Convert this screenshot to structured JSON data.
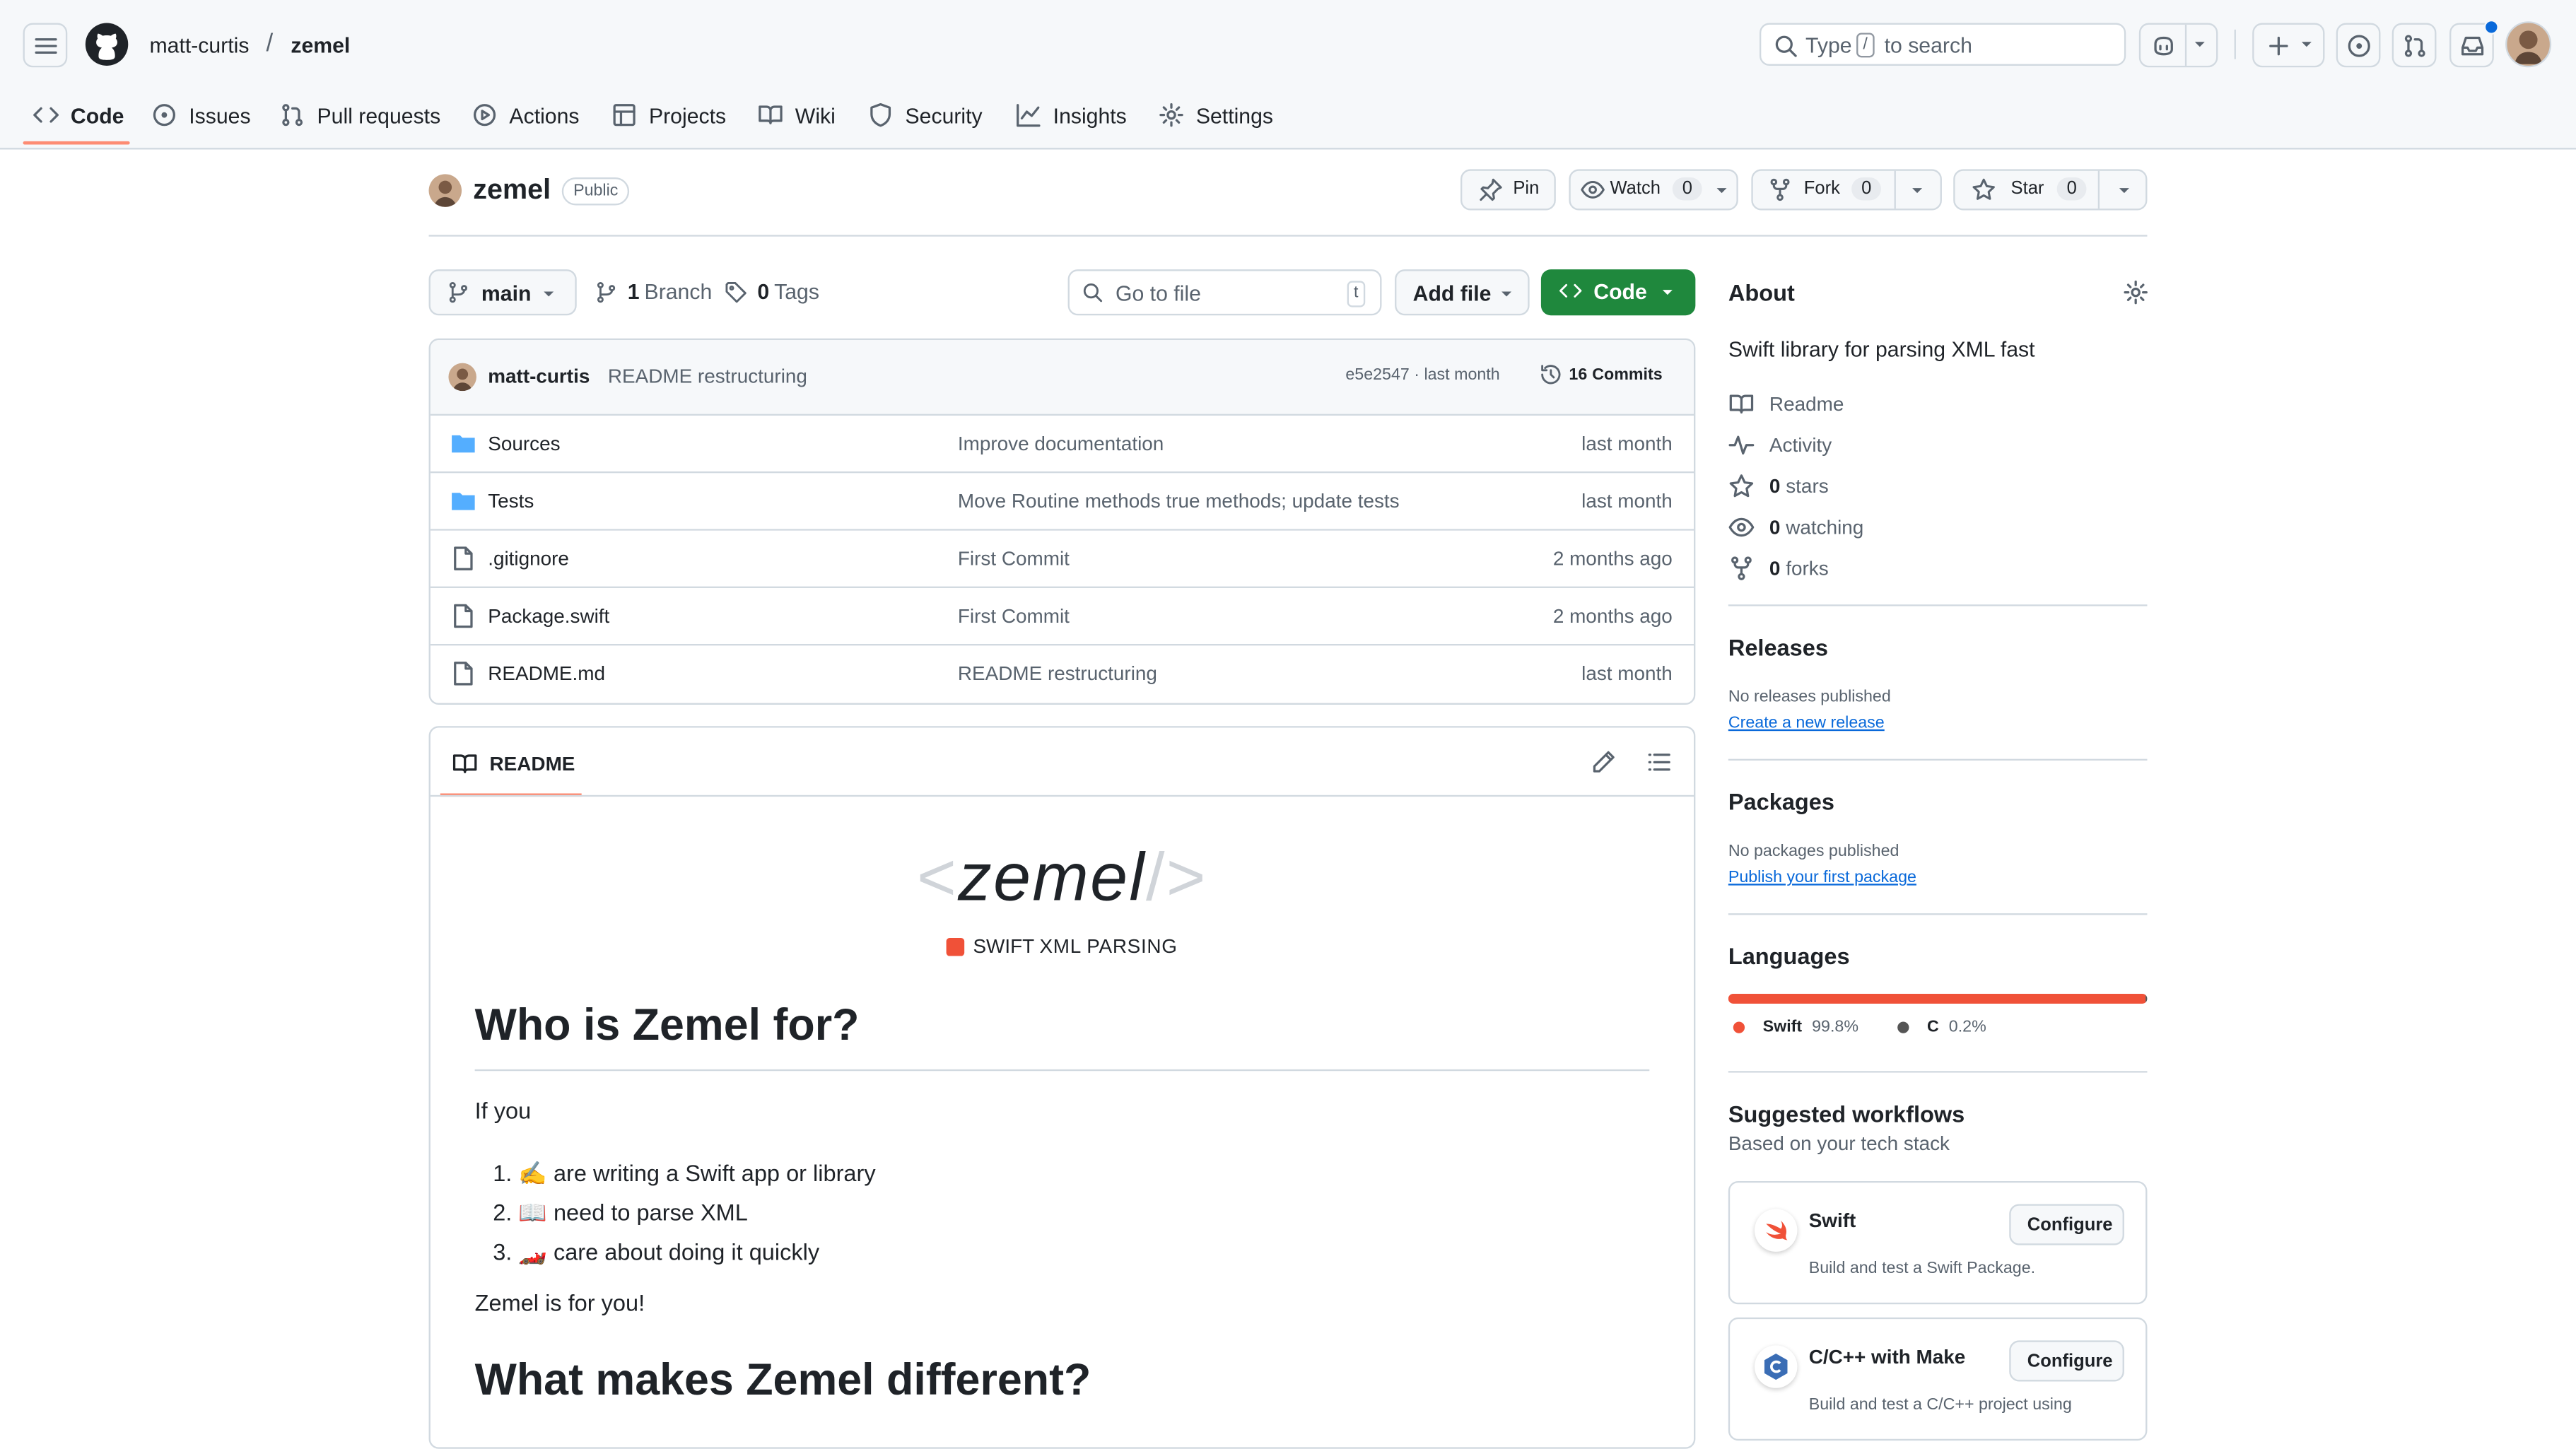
{
  "header": {
    "owner": "matt-curtis",
    "separator": "/",
    "repo": "zemel",
    "search_pre": "Type",
    "search_key": "/",
    "search_post": "to search",
    "notification_color": "#0969da"
  },
  "tabs": [
    {
      "label": "Code",
      "icon": "code-icon"
    },
    {
      "label": "Issues",
      "icon": "issue-icon"
    },
    {
      "label": "Pull requests",
      "icon": "pull-request-icon"
    },
    {
      "label": "Actions",
      "icon": "play-icon"
    },
    {
      "label": "Projects",
      "icon": "table-icon"
    },
    {
      "label": "Wiki",
      "icon": "book-icon"
    },
    {
      "label": "Security",
      "icon": "shield-icon"
    },
    {
      "label": "Insights",
      "icon": "graph-icon"
    },
    {
      "label": "Settings",
      "icon": "gear-icon"
    }
  ],
  "repo": {
    "name": "zemel",
    "visibility": "Public",
    "pin_label": "Pin",
    "watch_label": "Watch",
    "watch_count": "0",
    "fork_label": "Fork",
    "fork_count": "0",
    "star_label": "Star",
    "star_count": "0"
  },
  "toolbar": {
    "branch": "main",
    "branches_count": "1",
    "branches_label": "Branch",
    "tags_count": "0",
    "tags_label": "Tags",
    "go_to_file_placeholder": "Go to file",
    "go_to_file_key": "t",
    "add_file_label": "Add file",
    "code_label": "Code"
  },
  "commit": {
    "author": "matt-curtis",
    "message": "README restructuring",
    "hash_time": "e5e2547 · last month",
    "commits_count": "16",
    "commits_label": "Commits"
  },
  "files": [
    {
      "name": "Sources",
      "type": "dir",
      "message": "Improve documentation",
      "time": "last month"
    },
    {
      "name": "Tests",
      "type": "dir",
      "message": "Move Routine methods true methods; update tests",
      "time": "last month"
    },
    {
      "name": ".gitignore",
      "type": "file",
      "message": "First Commit",
      "time": "2 months ago"
    },
    {
      "name": "Package.swift",
      "type": "file",
      "message": "First Commit",
      "time": "2 months ago"
    },
    {
      "name": "README.md",
      "type": "file",
      "message": "README restructuring",
      "time": "last month"
    }
  ],
  "readme": {
    "tab_label": "README",
    "logo_open": "<",
    "logo_text": "zemel",
    "logo_close": "/>",
    "subtitle_a": "SWIFT ",
    "subtitle_b": "XML PARSING",
    "h1": "Who is Zemel for?",
    "intro": "If you",
    "list": [
      "✍️ are writing a Swift app or library",
      "📖 need to parse XML",
      "🏎️ care about doing it quickly"
    ],
    "closing": "Zemel is for you!",
    "h2": "What makes Zemel different?"
  },
  "about": {
    "title": "About",
    "description": "Swift library for parsing XML fast",
    "links": [
      {
        "icon": "book-icon",
        "bold": "",
        "label": "Readme"
      },
      {
        "icon": "pulse-icon",
        "bold": "",
        "label": "Activity"
      },
      {
        "icon": "star-icon",
        "bold": "0",
        "label": "stars"
      },
      {
        "icon": "eye-icon",
        "bold": "0",
        "label": "watching"
      },
      {
        "icon": "fork-icon",
        "bold": "0",
        "label": "forks"
      }
    ]
  },
  "releases": {
    "title": "Releases",
    "empty": "No releases published",
    "link": "Create a new release"
  },
  "packages": {
    "title": "Packages",
    "empty": "No packages published",
    "link": "Publish your first package"
  },
  "languages": {
    "title": "Languages",
    "items": [
      {
        "name": "Swift",
        "percent": "99.8%",
        "share": 99.8,
        "color": "#f05138"
      },
      {
        "name": "C",
        "percent": "0.2%",
        "share": 0.2,
        "color": "#555555"
      }
    ]
  },
  "workflows": {
    "title": "Suggested workflows",
    "subtitle": "Based on your tech stack",
    "items": [
      {
        "name": "Swift",
        "desc": "Build and test a Swift Package.",
        "button": "Configure"
      },
      {
        "name": "C/C++ with Make",
        "desc": "Build and test a C/C++ project using",
        "button": "Configure"
      }
    ]
  },
  "colors": {
    "accent_green": "#1f883d",
    "tab_underline": "#fd8c73",
    "link_blue": "#0969da",
    "folder_blue": "#54aeff"
  }
}
